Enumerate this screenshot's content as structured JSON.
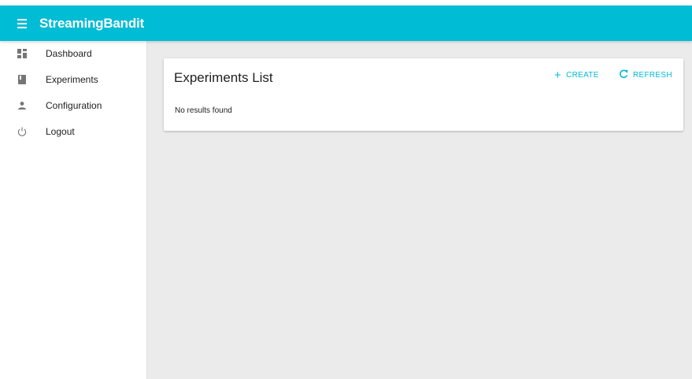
{
  "app": {
    "title": "StreamingBandit"
  },
  "sidebar": {
    "items": [
      {
        "label": "Dashboard",
        "icon": "dashboard-icon"
      },
      {
        "label": "Experiments",
        "icon": "book-icon"
      },
      {
        "label": "Configuration",
        "icon": "person-icon"
      },
      {
        "label": "Logout",
        "icon": "power-icon"
      }
    ]
  },
  "main": {
    "card": {
      "title": "Experiments List",
      "create_label": "CREATE",
      "refresh_label": "REFRESH",
      "empty_text": "No results found"
    }
  },
  "colors": {
    "accent": "#00bcd4",
    "background": "#ebebeb",
    "icon": "#757575"
  }
}
